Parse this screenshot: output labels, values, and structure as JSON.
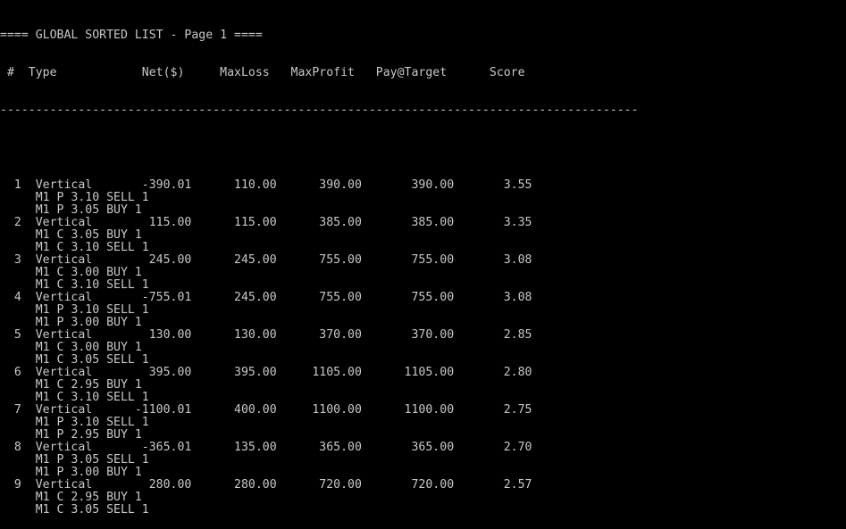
{
  "window": {
    "title": "==== GLOBAL SORTED LIST - Page 1 ====",
    "header": " #  Type            Net($)     MaxLoss   MaxProfit   Pay@Target      Score",
    "separator": "------------------------------------------------------------------------------------------"
  },
  "rows": [
    {
      "line": "  1  Vertical       -390.01      110.00      390.00       390.00       3.55",
      "legs": [
        "     M1 P 3.10 SELL 1",
        "     M1 P 3.05 BUY 1"
      ]
    },
    {
      "line": "  2  Vertical        115.00      115.00      385.00       385.00       3.35",
      "legs": [
        "     M1 C 3.05 BUY 1",
        "     M1 C 3.10 SELL 1"
      ]
    },
    {
      "line": "  3  Vertical        245.00      245.00      755.00       755.00       3.08",
      "legs": [
        "     M1 C 3.00 BUY 1",
        "     M1 C 3.10 SELL 1"
      ]
    },
    {
      "line": "  4  Vertical       -755.01      245.00      755.00       755.00       3.08",
      "legs": [
        "     M1 P 3.10 SELL 1",
        "     M1 P 3.00 BUY 1"
      ]
    },
    {
      "line": "  5  Vertical        130.00      130.00      370.00       370.00       2.85",
      "legs": [
        "     M1 C 3.00 BUY 1",
        "     M1 C 3.05 SELL 1"
      ]
    },
    {
      "line": "  6  Vertical        395.00      395.00     1105.00      1105.00       2.80",
      "legs": [
        "     M1 C 2.95 BUY 1",
        "     M1 C 3.10 SELL 1"
      ]
    },
    {
      "line": "  7  Vertical      -1100.01      400.00     1100.00      1100.00       2.75",
      "legs": [
        "     M1 P 3.10 SELL 1",
        "     M1 P 2.95 BUY 1"
      ]
    },
    {
      "line": "  8  Vertical       -365.01      135.00      365.00       365.00       2.70",
      "legs": [
        "     M1 P 3.05 SELL 1",
        "     M1 P 3.00 BUY 1"
      ]
    },
    {
      "line": "  9  Vertical        280.00      280.00      720.00       720.00       2.57",
      "legs": [
        "     M1 C 2.95 BUY 1",
        "     M1 C 3.05 SELL 1"
      ]
    }
  ]
}
